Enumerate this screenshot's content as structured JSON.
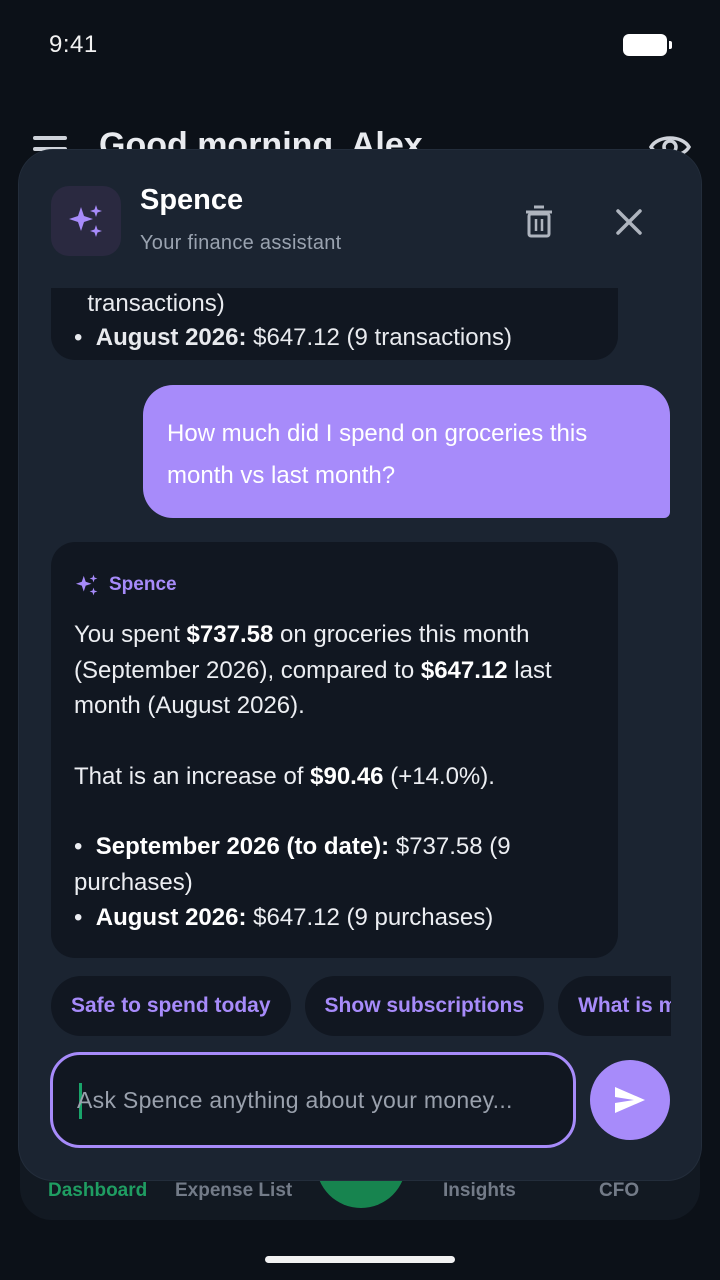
{
  "status_bar": {
    "time": "9:41"
  },
  "app": {
    "greeting": "Good morning, Alex"
  },
  "bottom_nav": {
    "items": [
      "Dashboard",
      "Expense List",
      "Insights",
      "CFO"
    ],
    "active": "Dashboard"
  },
  "chat": {
    "assistant_name": "Spence",
    "assistant_subtitle": "Your finance assistant",
    "messages": {
      "prev_assistant": {
        "cut_line": "transactions)",
        "last_item_label": "August 2026:",
        "last_item_value": " $647.12 (9 transactions)"
      },
      "user": "How much did I spend on groceries this month vs last month?",
      "assistant": {
        "sender": "Spence",
        "p1_a": "You spent ",
        "p1_amount1": "$737.58",
        "p1_b": " on groceries this month (September 2026), compared to ",
        "p1_amount2": "$647.12",
        "p1_c": " last month (August 2026).",
        "p2_a": "That is an increase of ",
        "p2_amount": "$90.46",
        "p2_b": " (+14.0%).",
        "bullet1_label": "September 2026 (to date):",
        "bullet1_value": " $737.58 (9 purchases)",
        "bullet2_label": "August 2026:",
        "bullet2_value": " $647.12 (9 purchases)"
      }
    },
    "suggestions": [
      "Safe to spend today",
      "Show subscriptions",
      "What is my"
    ],
    "input": {
      "placeholder": "Ask Spence anything about your money...",
      "value": ""
    }
  },
  "colors": {
    "accent": "#a78bfa",
    "success": "#1f9d62",
    "surface": "#1b2431",
    "bubble": "#111721"
  }
}
